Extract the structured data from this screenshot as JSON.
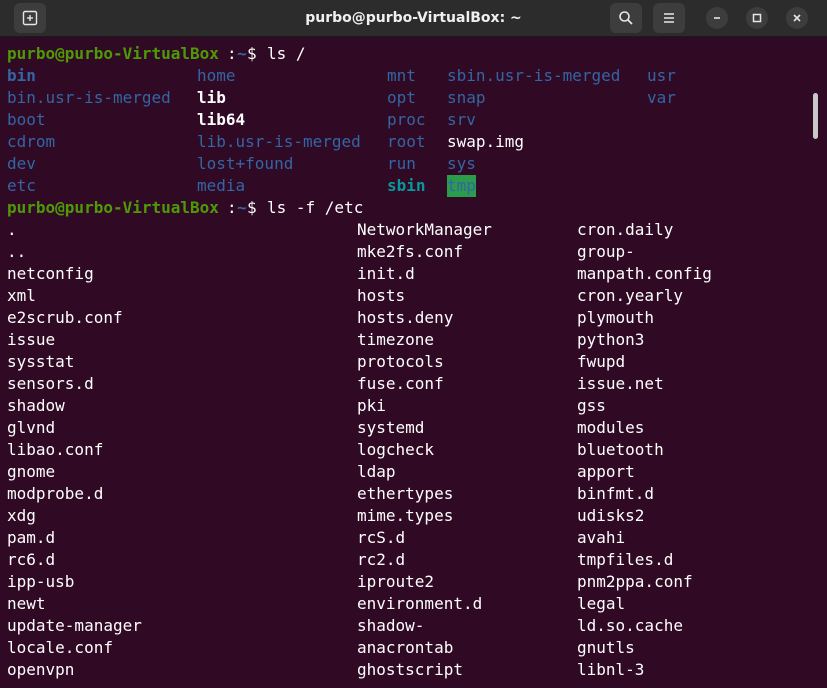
{
  "window": {
    "title": "purbo@purbo-VirtualBox: ~"
  },
  "icons": {
    "new_tab": "new-tab-icon",
    "search": "search-icon",
    "menu": "hamburger-menu-icon",
    "minimize": "minimize-icon",
    "maximize": "maximize-icon",
    "close": "close-icon"
  },
  "colors": {
    "terminal_bg": "#300a24",
    "titlebar_bg": "#2c2c2c",
    "prompt_user": "#4e9a06",
    "prompt_path": "#3465a4",
    "dir": "#3465a4",
    "symlink": "#06989a",
    "sticky_dir_bg": "#2a9c4c",
    "text": "#ffffff"
  },
  "prompt1": {
    "user": "purbo@purbo-VirtualBox",
    "sep": ":",
    "path": "~",
    "symbol": "$ ",
    "command": "ls /"
  },
  "prompt2": {
    "user": "purbo@purbo-VirtualBox",
    "sep": ":",
    "path": "~",
    "symbol": "$ ",
    "command": "ls -f /etc"
  },
  "root_listing": [
    [
      "bin",
      "home",
      "mnt",
      "sbin.usr-is-merged",
      "usr"
    ],
    [
      "bin.usr-is-merged",
      "lib",
      "opt",
      "snap",
      "var"
    ],
    [
      "boot",
      "lib64",
      "proc",
      "srv",
      ""
    ],
    [
      "cdrom",
      "lib.usr-is-merged",
      "root",
      "swap.img",
      ""
    ],
    [
      "dev",
      "lost+found",
      "run",
      "sys",
      ""
    ],
    [
      "etc",
      "media",
      "sbin",
      "tmp",
      ""
    ]
  ],
  "etc_listing": [
    [
      ".",
      "NetworkManager",
      "cron.daily"
    ],
    [
      "..",
      "mke2fs.conf",
      "group-"
    ],
    [
      "netconfig",
      "init.d",
      "manpath.config"
    ],
    [
      "xml",
      "hosts",
      "cron.yearly"
    ],
    [
      "e2scrub.conf",
      "hosts.deny",
      "plymouth"
    ],
    [
      "issue",
      "timezone",
      "python3"
    ],
    [
      "sysstat",
      "protocols",
      "fwupd"
    ],
    [
      "sensors.d",
      "fuse.conf",
      "issue.net"
    ],
    [
      "shadow",
      "pki",
      "gss"
    ],
    [
      "glvnd",
      "systemd",
      "modules"
    ],
    [
      "libao.conf",
      "logcheck",
      "bluetooth"
    ],
    [
      "gnome",
      "ldap",
      "apport"
    ],
    [
      "modprobe.d",
      "ethertypes",
      "binfmt.d"
    ],
    [
      "xdg",
      "mime.types",
      "udisks2"
    ],
    [
      "pam.d",
      "rcS.d",
      "avahi"
    ],
    [
      "rc6.d",
      "rc2.d",
      "tmpfiles.d"
    ],
    [
      "ipp-usb",
      "iproute2",
      "pnm2ppa.conf"
    ],
    [
      "newt",
      "environment.d",
      "legal"
    ],
    [
      "update-manager",
      "shadow-",
      "ld.so.cache"
    ],
    [
      "locale.conf",
      "anacrontab",
      "gnutls"
    ],
    [
      "openvpn",
      "ghostscript",
      "libnl-3"
    ]
  ]
}
